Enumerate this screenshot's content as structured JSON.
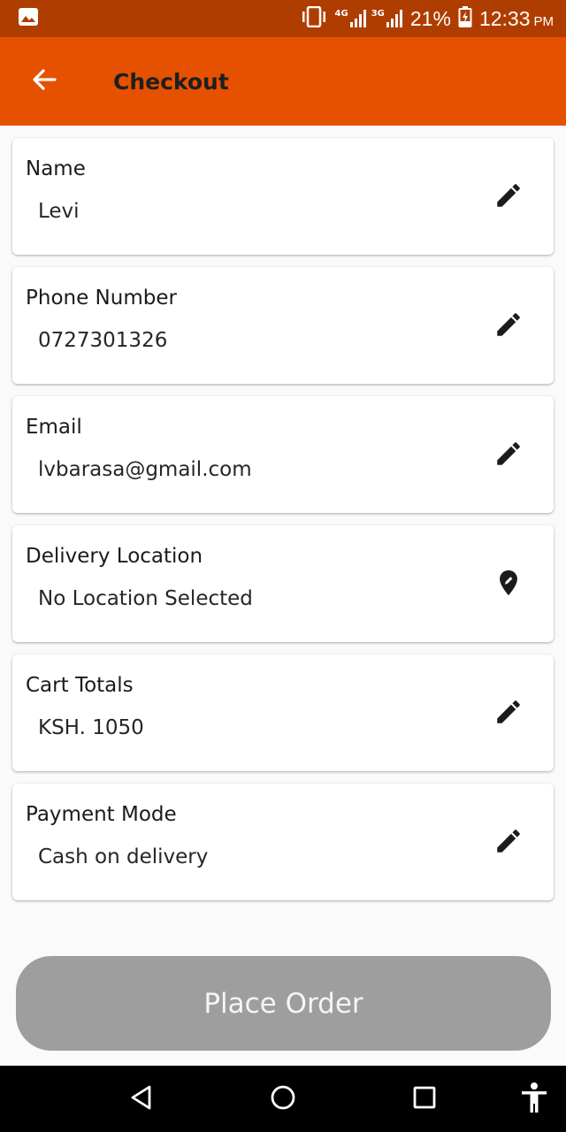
{
  "status_bar": {
    "net1": "4G",
    "net2": "3G",
    "battery": "21%",
    "time": "12:33",
    "ampm": "PM",
    "icons": [
      "image-icon",
      "vibrate-icon",
      "signal-icon",
      "battery-charging-icon"
    ]
  },
  "app_bar": {
    "title": "Checkout",
    "back_icon": "arrow-left-icon"
  },
  "fields": [
    {
      "label": "Name",
      "value": "Levi",
      "action_icon": "pencil-icon"
    },
    {
      "label": "Phone Number",
      "value": "0727301326",
      "action_icon": "pencil-icon"
    },
    {
      "label": "Email",
      "value": "lvbarasa@gmail.com",
      "action_icon": "pencil-icon"
    },
    {
      "label": "Delivery Location",
      "value": "No Location Selected",
      "action_icon": "location-pin-icon"
    },
    {
      "label": "Cart Totals",
      "value": "KSH. 1050",
      "action_icon": "pencil-icon"
    },
    {
      "label": "Payment Mode",
      "value": "Cash on delivery",
      "action_icon": "pencil-icon"
    }
  ],
  "place_order_label": "Place Order",
  "colors": {
    "status_bar": "#b03d00",
    "app_bar": "#e65100",
    "button_disabled": "#9e9e9e"
  },
  "nav_bar": {
    "icons": [
      "back-triangle-icon",
      "home-circle-icon",
      "recents-square-icon",
      "accessibility-icon"
    ]
  }
}
